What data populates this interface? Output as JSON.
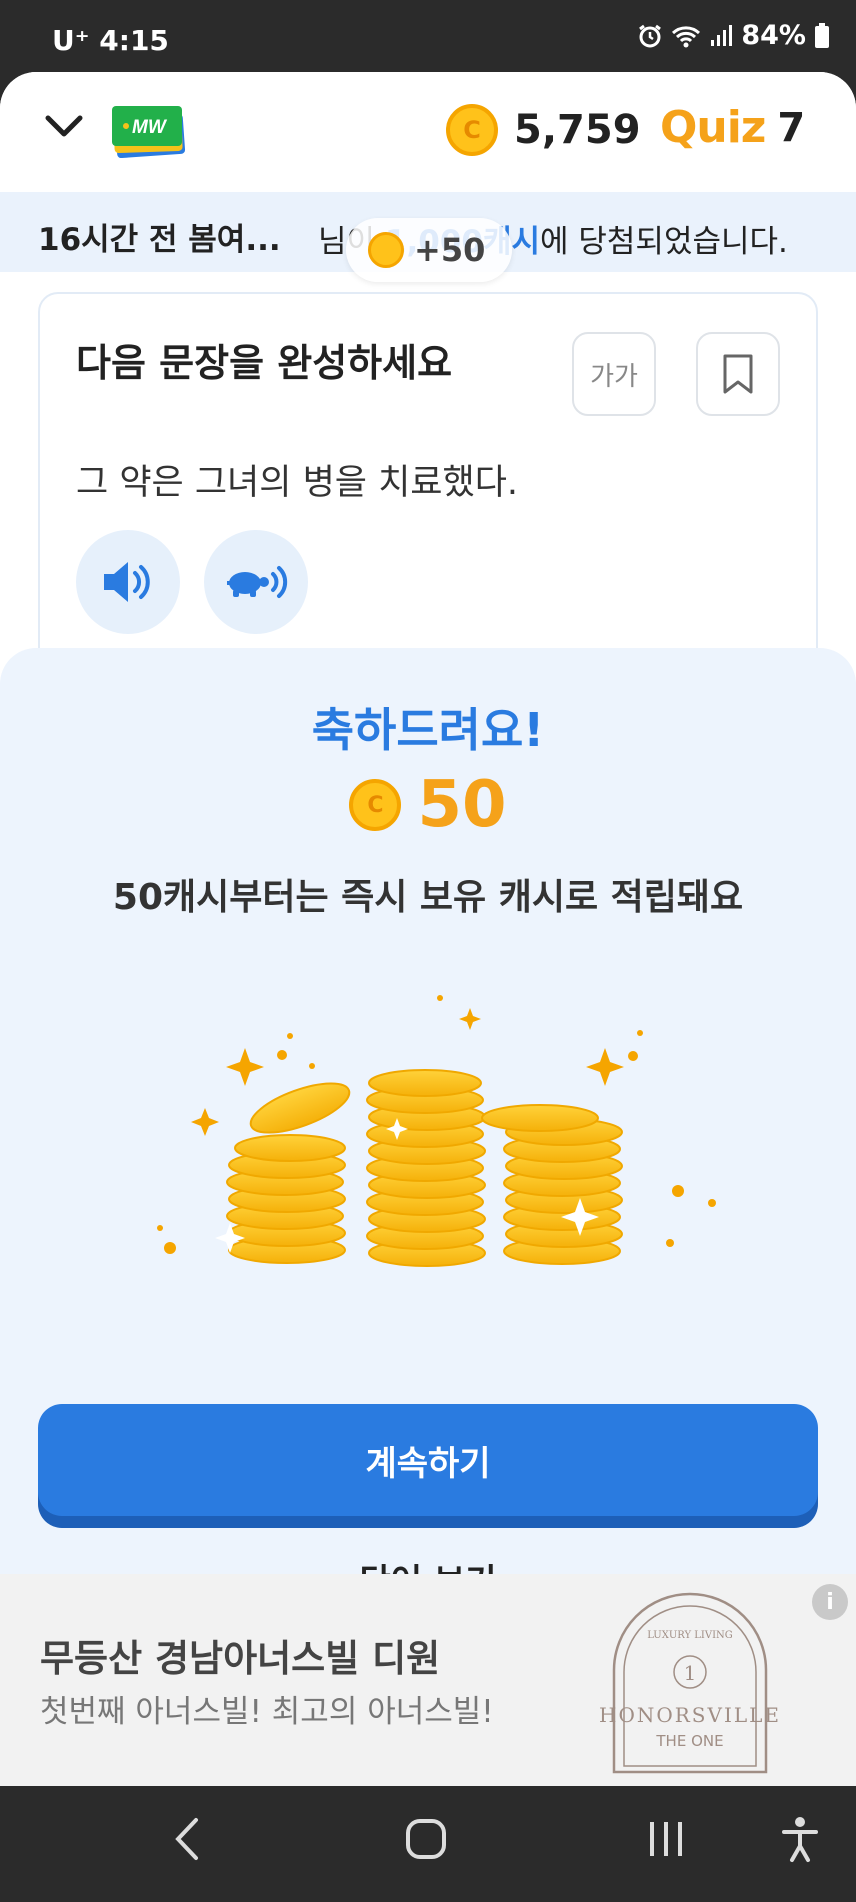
{
  "status_bar": {
    "carrier_time": "U⁺ 4:15",
    "battery": "84%"
  },
  "header": {
    "logo_text": "MW",
    "cash_coin_letter": "C",
    "cash": "5,759",
    "quiz_label": "Quiz",
    "quiz_count": "7"
  },
  "ticker": {
    "left": "16시간 전 봄여...",
    "prefix": "님이 ",
    "highlight": "1,000캐시",
    "suffix": "에 당첨되었습니다.",
    "plus_badge": "+50"
  },
  "question": {
    "title": "다음 문장을 완성하세요",
    "font_button_label": "가가",
    "sentence": "그 약은 그녀의 병을 치료했다."
  },
  "reward_sheet": {
    "title": "축하드려요!",
    "coin_letter": "C",
    "amount": "50",
    "notice": "50캐시부터는 즉시 보유 캐시로 적립돼요",
    "continue_label": "계속하기",
    "view_word_label": "단어 보기"
  },
  "ad": {
    "title": "무등산 경남아너스빌 디원",
    "subtitle": "첫번째 아너스빌! 최고의 아너스빌!",
    "info_label": "i",
    "logo_top": "LUXURY LIVING",
    "logo_numeral": "1",
    "logo_brand": "HONORSVILLE",
    "logo_sub": "THE ONE"
  },
  "colors": {
    "accent_blue": "#2a7be0",
    "coin_gold": "#f5a21a",
    "sheet_bg": "#edf4fd"
  }
}
